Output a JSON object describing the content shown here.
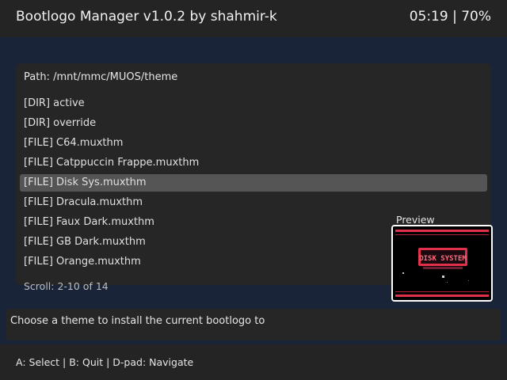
{
  "header": {
    "title": "Bootlogo Manager v1.0.2 by shahmir-k",
    "status": "05:19 | 70%"
  },
  "browser": {
    "path": "Path: /mnt/mmc/MUOS/theme",
    "items": [
      "[DIR] active",
      "[DIR] override",
      "[FILE] C64.muxthm",
      "[FILE] Catppuccin Frappe.muxthm",
      "[FILE] Disk Sys.muxthm",
      "[FILE] Dracula.muxthm",
      "[FILE] Faux Dark.muxthm",
      "[FILE] GB Dark.muxthm",
      "[FILE] Orange.muxthm"
    ],
    "selected_index": 4,
    "scroll": "Scroll: 2-10 of 14"
  },
  "preview": {
    "label": "Preview",
    "logo_text": "DISK SYSTEM"
  },
  "prompt": {
    "text": "Choose a theme to install the current bootlogo to"
  },
  "footer": {
    "controls": "A: Select | B: Quit | D-pad: Navigate"
  },
  "colors": {
    "background": "#1a2438",
    "panel": "#262626",
    "header": "#242424",
    "selection": "#555555",
    "preview_red": "#e0304a"
  }
}
